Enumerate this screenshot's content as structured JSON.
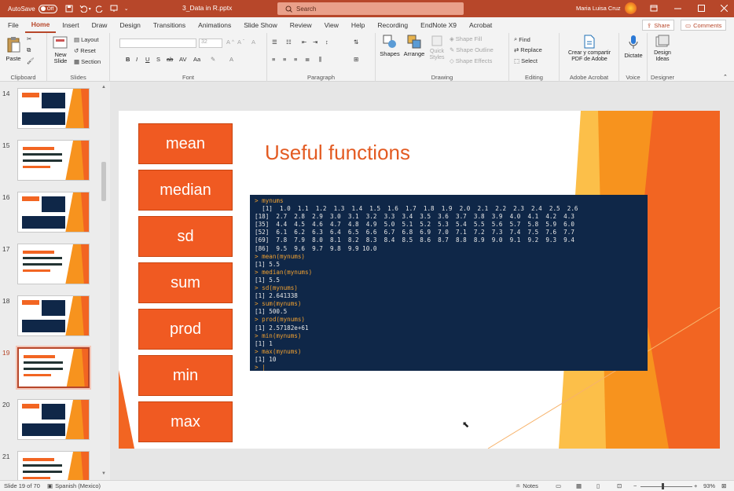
{
  "titlebar": {
    "autosave_label": "AutoSave",
    "autosave_state": "Off",
    "filename": "3_Data in R.pptx",
    "search_placeholder": "Search",
    "user": "Maria Luisa Cruz"
  },
  "tabs": [
    "File",
    "Home",
    "Insert",
    "Draw",
    "Design",
    "Transitions",
    "Animations",
    "Slide Show",
    "Review",
    "View",
    "Help",
    "Recording",
    "EndNote X9",
    "Acrobat"
  ],
  "share_label": "Share",
  "comments_label": "Comments",
  "ribbon": {
    "clipboard": {
      "label": "Clipboard",
      "paste": "Paste"
    },
    "slides": {
      "label": "Slides",
      "new_slide": "New Slide",
      "layout": "Layout",
      "reset": "Reset",
      "section": "Section"
    },
    "font": {
      "label": "Font",
      "size": "32"
    },
    "paragraph": {
      "label": "Paragraph"
    },
    "drawing": {
      "label": "Drawing",
      "shapes": "Shapes",
      "arrange": "Arrange",
      "quick_styles": "Quick Styles",
      "shape_fill": "Shape Fill",
      "shape_outline": "Shape Outline",
      "shape_effects": "Shape Effects"
    },
    "editing": {
      "label": "Editing",
      "find": "Find",
      "replace": "Replace",
      "select": "Select"
    },
    "acrobat": {
      "label": "Adobe Acrobat",
      "create": "Crear y compartir PDF de Adobe"
    },
    "voice": {
      "label": "Voice",
      "dictate": "Dictate"
    },
    "designer": {
      "label": "Designer",
      "ideas": "Design Ideas"
    }
  },
  "thumbnails": [
    {
      "num": "14"
    },
    {
      "num": "15"
    },
    {
      "num": "16"
    },
    {
      "num": "17"
    },
    {
      "num": "18"
    },
    {
      "num": "19",
      "selected": true
    },
    {
      "num": "20"
    },
    {
      "num": "21"
    }
  ],
  "slide": {
    "title": "Useful functions",
    "functions": [
      "mean",
      "median",
      "sd",
      "sum",
      "prod",
      "min",
      "max"
    ],
    "console": [
      {
        "t": "cmd",
        "s": "> mynums"
      },
      {
        "t": "out",
        "s": "  [1]  1.0  1.1  1.2  1.3  1.4  1.5  1.6  1.7  1.8  1.9  2.0  2.1  2.2  2.3  2.4  2.5  2.6"
      },
      {
        "t": "out",
        "s": "[18]  2.7  2.8  2.9  3.0  3.1  3.2  3.3  3.4  3.5  3.6  3.7  3.8  3.9  4.0  4.1  4.2  4.3"
      },
      {
        "t": "out",
        "s": "[35]  4.4  4.5  4.6  4.7  4.8  4.9  5.0  5.1  5.2  5.3  5.4  5.5  5.6  5.7  5.8  5.9  6.0"
      },
      {
        "t": "out",
        "s": "[52]  6.1  6.2  6.3  6.4  6.5  6.6  6.7  6.8  6.9  7.0  7.1  7.2  7.3  7.4  7.5  7.6  7.7"
      },
      {
        "t": "out",
        "s": "[69]  7.8  7.9  8.0  8.1  8.2  8.3  8.4  8.5  8.6  8.7  8.8  8.9  9.0  9.1  9.2  9.3  9.4"
      },
      {
        "t": "out",
        "s": "[86]  9.5  9.6  9.7  9.8  9.9 10.0"
      },
      {
        "t": "cmd",
        "s": "> mean(mynums)"
      },
      {
        "t": "out",
        "s": "[1] 5.5"
      },
      {
        "t": "cmd",
        "s": "> median(mynums)"
      },
      {
        "t": "out",
        "s": "[1] 5.5"
      },
      {
        "t": "cmd",
        "s": "> sd(mynums)"
      },
      {
        "t": "out",
        "s": "[1] 2.641338"
      },
      {
        "t": "cmd",
        "s": "> sum(mynums)"
      },
      {
        "t": "out",
        "s": "[1] 500.5"
      },
      {
        "t": "cmd",
        "s": "> prod(mynums)"
      },
      {
        "t": "out",
        "s": "[1] 2.57182e+61"
      },
      {
        "t": "cmd",
        "s": "> min(mynums)"
      },
      {
        "t": "out",
        "s": "[1] 1"
      },
      {
        "t": "cmd",
        "s": "> max(mynums)"
      },
      {
        "t": "out",
        "s": "[1] 10"
      },
      {
        "t": "cmd",
        "s": "> |"
      }
    ]
  },
  "status": {
    "slide_of": "Slide 19 of 70",
    "language": "Spanish (Mexico)",
    "notes": "Notes",
    "zoom": "93%"
  },
  "colors": {
    "brand": "#b7472a",
    "accent_orange": "#f05a22",
    "console_bg": "#0f2748",
    "prompt": "#f0a030"
  }
}
